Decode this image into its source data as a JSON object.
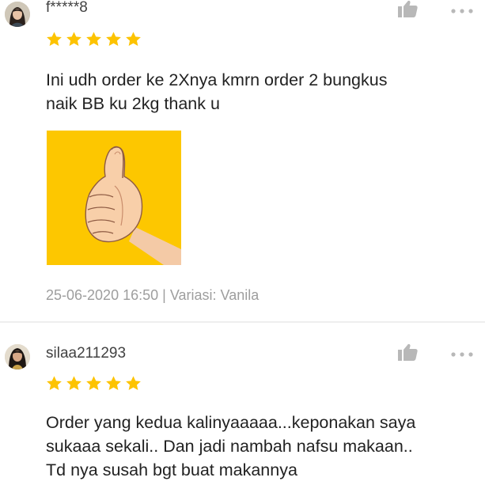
{
  "reviews": [
    {
      "username": "f*****8",
      "rating": 5,
      "comment_lines": [
        "Ini udh order ke 2Xnya kmrn order 2 bungkus",
        "naik BB ku 2kg thank u"
      ],
      "has_image": true,
      "date": "25-06-2020 16:50",
      "separator": "|",
      "variant": "Variasi: Vanila"
    },
    {
      "username": "silaa211293",
      "rating": 5,
      "comment_lines": [
        "Order yang kedua kalinyaaaaa...keponakan saya",
        "sukaaa sekali.. Dan jadi nambah nafsu makaan..",
        "Td nya susah bgt buat makannya"
      ]
    }
  ],
  "icons": {
    "like": "thumbs-up-icon",
    "more": "more-dots-icon",
    "star": "star-icon"
  },
  "colors": {
    "star": "#fdc300",
    "icon_gray": "#b8b8b8",
    "meta_text": "#9e9e9e",
    "image_bg": "#fdc700",
    "divider": "#eeeeee"
  }
}
